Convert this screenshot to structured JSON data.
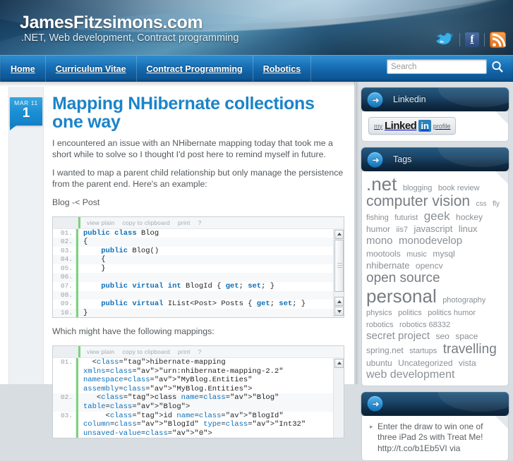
{
  "header": {
    "site_title": "JamesFitzsimons.com",
    "tagline": ".NET, Web development, Contract programming",
    "social": [
      {
        "name": "twitter-icon",
        "label": "Twitter"
      },
      {
        "name": "facebook-icon",
        "label": "f"
      },
      {
        "name": "rss-icon",
        "label": "RSS"
      }
    ]
  },
  "nav": {
    "items": [
      {
        "label": "Home"
      },
      {
        "label": "Curriculum Vitae"
      },
      {
        "label": "Contract Programming"
      },
      {
        "label": "Robotics"
      }
    ]
  },
  "search": {
    "value": "",
    "placeholder": "Search",
    "icon": "search-icon"
  },
  "post": {
    "date_month": "MAR 11",
    "date_day": "1",
    "title": "Mapping NHibernate collections one way",
    "paragraphs": [
      "I encountered an issue with an NHibernate mapping today that took me a short while to solve so I thought I'd post here to remind myself in future.",
      "I wanted to map a parent child relationship but only manage the persistence from the parent end. Here's an example:",
      "Blog -< Post"
    ],
    "interstitial": "Which might have the following mappings:"
  },
  "code_toolbar": {
    "links": [
      "view plain",
      "copy to clipboard",
      "print",
      "?"
    ]
  },
  "code_block_1": {
    "lines": [
      {
        "n": "01.",
        "code": "public class Blog"
      },
      {
        "n": "02.",
        "code": "{"
      },
      {
        "n": "03.",
        "code": "    public Blog()"
      },
      {
        "n": "04.",
        "code": "    {"
      },
      {
        "n": "05.",
        "code": "    }"
      },
      {
        "n": "06.",
        "code": ""
      },
      {
        "n": "07.",
        "code": "    public virtual int BlogId { get; set; }"
      },
      {
        "n": "08.",
        "code": ""
      },
      {
        "n": "09.",
        "code": "    public virtual IList<Post> Posts { get; set; }"
      },
      {
        "n": "10.",
        "code": "}"
      }
    ]
  },
  "code_block_2": {
    "lines": [
      {
        "n": "01.",
        "code": "  <hibernate-mapping xmlns=\"urn:nhibernate-mapping-2.2\" namespace=\"MyBlog.Entities\" assembly=\"MyBlog.Entities\">"
      },
      {
        "n": "02.",
        "code": "   <class name=\"Blog\" table=\"Blog\">"
      },
      {
        "n": "03.",
        "code": "     <id name=\"BlogId\" column=\"BlogId\" type=\"Int32\" unsaved-value=\"0\">"
      }
    ]
  },
  "sidebar": {
    "widgets": [
      {
        "name": "linkedin-widget",
        "title": "Linkedin",
        "badge": {
          "my": "my",
          "linked": "Linked",
          "in": "in",
          "profile": "profile"
        }
      },
      {
        "name": "tags-widget",
        "title": "Tags",
        "tags": [
          {
            "label": ".net",
            "size": 26
          },
          {
            "label": "blogging",
            "size": 11
          },
          {
            "label": "book review",
            "size": 11
          },
          {
            "label": "computer vision",
            "size": 21
          },
          {
            "label": "css",
            "size": 10
          },
          {
            "label": "fly",
            "size": 10
          },
          {
            "label": "fishing",
            "size": 11
          },
          {
            "label": "futurist",
            "size": 11
          },
          {
            "label": "geek",
            "size": 17
          },
          {
            "label": "hockey",
            "size": 12
          },
          {
            "label": "humor",
            "size": 12
          },
          {
            "label": "iis7",
            "size": 11
          },
          {
            "label": "javascript",
            "size": 13
          },
          {
            "label": "linux",
            "size": 13
          },
          {
            "label": "mono",
            "size": 15
          },
          {
            "label": "monodevelop",
            "size": 15
          },
          {
            "label": "mootools",
            "size": 12
          },
          {
            "label": "music",
            "size": 11
          },
          {
            "label": "mysql",
            "size": 12
          },
          {
            "label": "nhibernate",
            "size": 13
          },
          {
            "label": "opencv",
            "size": 12
          },
          {
            "label": "open source",
            "size": 19
          },
          {
            "label": "personal",
            "size": 26
          },
          {
            "label": "photography",
            "size": 11
          },
          {
            "label": "physics",
            "size": 11
          },
          {
            "label": "politics",
            "size": 11
          },
          {
            "label": "politics humor",
            "size": 11
          },
          {
            "label": "robotics",
            "size": 11
          },
          {
            "label": "robotics 68332",
            "size": 11
          },
          {
            "label": "secret project",
            "size": 15
          },
          {
            "label": "seo",
            "size": 12
          },
          {
            "label": "space",
            "size": 12
          },
          {
            "label": "spring.net",
            "size": 12
          },
          {
            "label": "startups",
            "size": 11
          },
          {
            "label": "travelling",
            "size": 19
          },
          {
            "label": "ubuntu",
            "size": 12
          },
          {
            "label": "Uncategorized",
            "size": 12
          },
          {
            "label": "vista",
            "size": 12
          },
          {
            "label": "web development",
            "size": 16
          }
        ]
      },
      {
        "name": "twitter-widget",
        "title": "",
        "tweets": [
          "Enter the draw to win one of three iPad 2s with Treat Me! http://t.co/b1Eb5VI via"
        ]
      }
    ]
  },
  "colors": {
    "accent_blue": "#1b84c9",
    "nav_blue": "#1a72b8",
    "header_dark": "#12304b",
    "widget_head": "#1b4568",
    "code_keyword": "#0d6fb8",
    "code_attr_value": "#d13b2e",
    "tag_gray": "#8a9096",
    "rss_orange": "#e06a15"
  }
}
